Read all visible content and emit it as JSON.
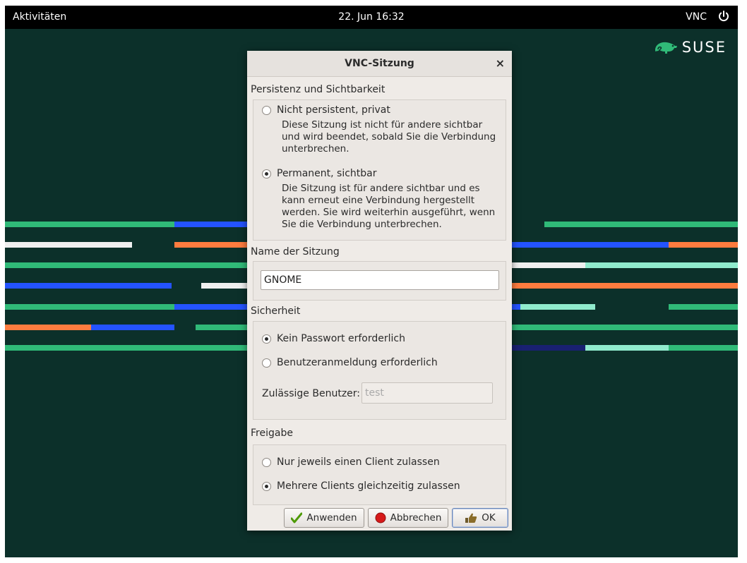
{
  "topbar": {
    "activities": "Aktivitäten",
    "clock": "22. Jun  16:32",
    "vnc": "VNC",
    "power_icon": "power-icon"
  },
  "brand": {
    "name": "SUSE",
    "color": "#30ba78"
  },
  "dialog": {
    "title": "VNC-Sitzung",
    "close_label": "×",
    "persistence": {
      "title": "Persistenz und Sichtbarkeit",
      "options": [
        {
          "label": "Nicht persistent, privat",
          "description": "Diese Sitzung ist nicht für andere sichtbar und wird beendet, sobald Sie die Verbindung unterbrechen.",
          "selected": false
        },
        {
          "label": "Permanent, sichtbar",
          "description": "Die Sitzung ist für andere sichtbar und es kann erneut eine Verbindung hergestellt werden. Sie wird weiterhin ausgeführt, wenn Sie die Verbindung unterbrechen.",
          "selected": true
        }
      ]
    },
    "session_name": {
      "title": "Name der Sitzung",
      "value": "GNOME"
    },
    "security": {
      "title": "Sicherheit",
      "options": [
        {
          "label": "Kein Passwort erforderlich",
          "selected": true
        },
        {
          "label": "Benutzeranmeldung erforderlich",
          "selected": false
        }
      ],
      "allowed_users_label": "Zulässige Benutzer:",
      "allowed_users_value": "test"
    },
    "sharing": {
      "title": "Freigabe",
      "options": [
        {
          "label": "Nur jeweils einen Client zulassen",
          "selected": false
        },
        {
          "label": "Mehrere Clients gleichzeitig zulassen",
          "selected": true
        }
      ]
    },
    "buttons": {
      "apply": "Anwenden",
      "cancel": "Abbrechen",
      "ok": "OK"
    }
  },
  "colors": {
    "desktop_bg": "#0c302a",
    "stripe_green": "#30ba78",
    "stripe_blue": "#2453ff",
    "stripe_orange": "#fe7c3f",
    "stripe_white": "#efefef",
    "stripe_mint": "#90ebcd",
    "stripe_navy": "#192072"
  }
}
